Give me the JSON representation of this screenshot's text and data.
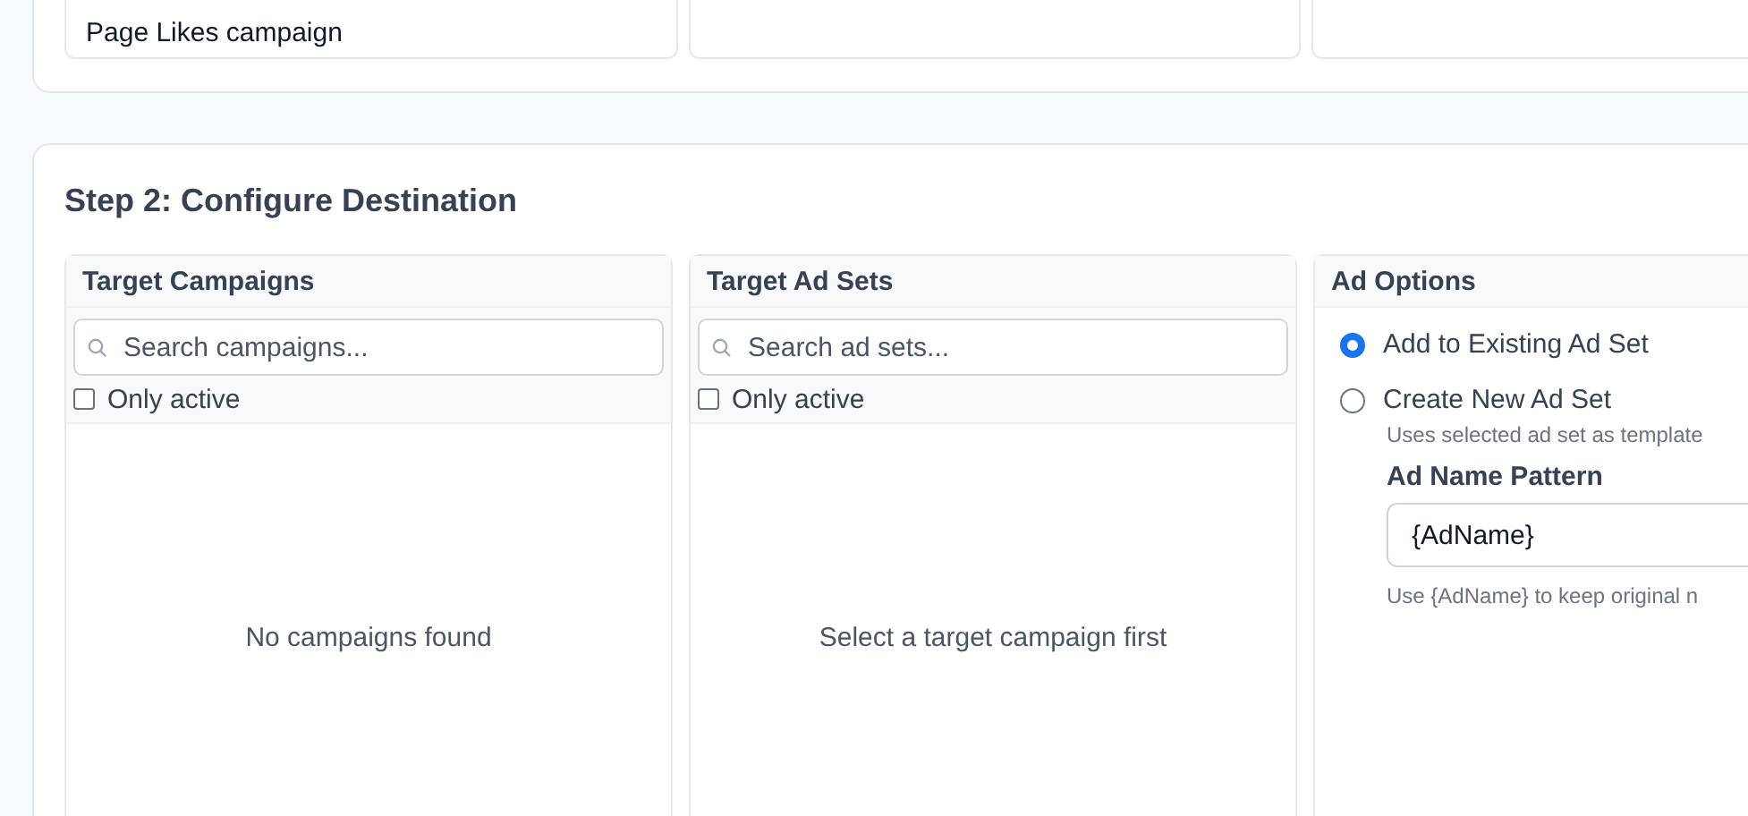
{
  "top_section": {
    "columns": [
      {
        "text": "Page Likes campaign"
      },
      {},
      {}
    ]
  },
  "step2": {
    "title": "Step 2: Configure Destination",
    "campaigns_panel": {
      "title": "Target Campaigns",
      "search": {
        "placeholder": "Search campaigns..."
      },
      "only_active": {
        "label": "Only active",
        "checked": false
      },
      "empty_message": "No campaigns found"
    },
    "adsets_panel": {
      "title": "Target Ad Sets",
      "search": {
        "placeholder": "Search ad sets..."
      },
      "only_active": {
        "label": "Only active",
        "checked": false
      },
      "empty_message": "Select a target campaign first"
    },
    "ad_options": {
      "title": "Ad Options",
      "options": [
        {
          "label": "Add to Existing Ad Set",
          "selected": true
        },
        {
          "label": "Create New Ad Set",
          "selected": false,
          "hint": "Uses selected ad set as template"
        }
      ],
      "name_pattern": {
        "label": "Ad Name Pattern",
        "value": "{AdName}",
        "hint": "Use {AdName} to keep original n"
      }
    }
  }
}
